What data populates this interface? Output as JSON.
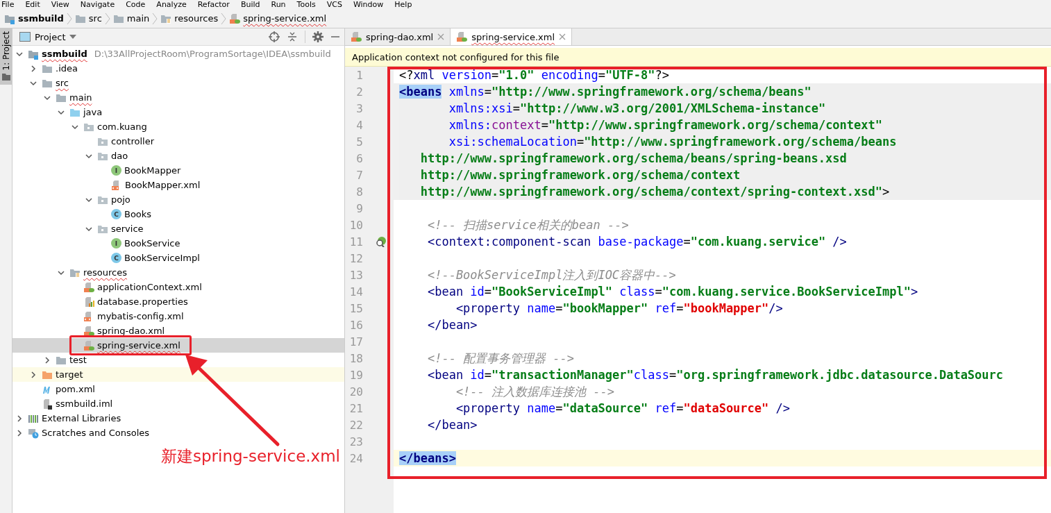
{
  "menu": [
    "File",
    "Edit",
    "View",
    "Navigate",
    "Code",
    "Analyze",
    "Refactor",
    "Build",
    "Run",
    "Tools",
    "VCS",
    "Window",
    "Help"
  ],
  "breadcrumbs": [
    {
      "label": "ssmbuild",
      "kind": "module"
    },
    {
      "label": "src",
      "kind": "folder"
    },
    {
      "label": "main",
      "kind": "folder"
    },
    {
      "label": "resources",
      "kind": "resources"
    },
    {
      "label": "spring-service.xml",
      "kind": "spring-xml",
      "typo": true
    }
  ],
  "tool_stripe": {
    "label": "1: Project"
  },
  "project": {
    "title": "Project",
    "tree": [
      {
        "label": "ssmbuild",
        "path": "D:\\33AllProjectRoom\\ProgramSortage\\IDEA\\ssmbuild",
        "kind": "module",
        "expanded": true,
        "selected": false,
        "typo": true,
        "children": [
          {
            "label": ".idea",
            "kind": "folder",
            "expanded": false,
            "selected": false
          },
          {
            "label": "src",
            "kind": "folder",
            "expanded": true,
            "selected": false,
            "typo": true,
            "children": [
              {
                "label": "main",
                "kind": "folder",
                "expanded": true,
                "selected": false,
                "typo": true,
                "children": [
                  {
                    "label": "java",
                    "kind": "source",
                    "expanded": true,
                    "selected": false,
                    "children": [
                      {
                        "label": "com.kuang",
                        "kind": "package",
                        "expanded": true,
                        "selected": false,
                        "children": [
                          {
                            "label": "controller",
                            "kind": "package",
                            "selected": false
                          },
                          {
                            "label": "dao",
                            "kind": "package",
                            "expanded": true,
                            "selected": false,
                            "children": [
                              {
                                "label": "BookMapper",
                                "kind": "interface",
                                "letter": "I",
                                "selected": false
                              },
                              {
                                "label": "BookMapper.xml",
                                "kind": "xml",
                                "selected": false
                              }
                            ]
                          },
                          {
                            "label": "pojo",
                            "kind": "package",
                            "expanded": true,
                            "selected": false,
                            "children": [
                              {
                                "label": "Books",
                                "kind": "class",
                                "letter": "C",
                                "selected": false
                              }
                            ]
                          },
                          {
                            "label": "service",
                            "kind": "package",
                            "expanded": true,
                            "selected": false,
                            "children": [
                              {
                                "label": "BookService",
                                "kind": "interface",
                                "letter": "I",
                                "selected": false
                              },
                              {
                                "label": "BookServiceImpl",
                                "kind": "class",
                                "letter": "C",
                                "selected": false
                              }
                            ]
                          }
                        ]
                      }
                    ]
                  },
                  {
                    "label": "resources",
                    "kind": "resources",
                    "expanded": true,
                    "selected": false,
                    "typo": true,
                    "children": [
                      {
                        "label": "applicationContext.xml",
                        "kind": "spring-xml",
                        "selected": false
                      },
                      {
                        "label": "database.properties",
                        "kind": "properties",
                        "selected": false
                      },
                      {
                        "label": "mybatis-config.xml",
                        "kind": "xml",
                        "selected": false
                      },
                      {
                        "label": "spring-dao.xml",
                        "kind": "spring-xml",
                        "selected": false
                      },
                      {
                        "label": "spring-service.xml",
                        "kind": "spring-xml",
                        "selected": true,
                        "typo": true
                      }
                    ]
                  }
                ]
              },
              {
                "label": "test",
                "kind": "folder",
                "expanded": false,
                "selected": false
              }
            ]
          },
          {
            "label": "target",
            "kind": "excluded",
            "expanded": false,
            "selected": false
          },
          {
            "label": "pom.xml",
            "kind": "maven",
            "selected": false
          },
          {
            "label": "ssmbuild.iml",
            "kind": "iml",
            "selected": false
          }
        ]
      },
      {
        "label": "External Libraries",
        "kind": "libraries",
        "expanded": false,
        "selected": false
      },
      {
        "label": "Scratches and Consoles",
        "kind": "scratches",
        "expanded": false,
        "selected": false
      }
    ]
  },
  "tabs": [
    {
      "label": "spring-dao.xml",
      "selected": false
    },
    {
      "label": "spring-service.xml",
      "selected": true,
      "typo": true
    }
  ],
  "banner": "Application context not configured for this file",
  "editor": {
    "lines": [
      {
        "n": "1",
        "kind": "plain",
        "tokens": [
          {
            "kind": "p",
            "text": "<?"
          },
          {
            "kind": "tag",
            "text": "xml"
          },
          {
            "kind": "attr",
            "text": " version"
          },
          {
            "kind": "p",
            "text": "="
          },
          {
            "kind": "val",
            "text": "\"1.0\""
          },
          {
            "kind": "attr",
            "text": " encoding"
          },
          {
            "kind": "p",
            "text": "="
          },
          {
            "kind": "val",
            "text": "\"UTF-8\""
          },
          {
            "kind": "p",
            "text": "?>"
          }
        ]
      },
      {
        "n": "2",
        "kind": "scope",
        "tokens": [
          {
            "kind": "match",
            "text": "<beans"
          },
          {
            "kind": "attr",
            "text": " xmlns"
          },
          {
            "kind": "p",
            "text": "="
          },
          {
            "kind": "val",
            "text": "\"http://www.springframework.org/schema/beans\""
          }
        ]
      },
      {
        "n": "3",
        "kind": "scope",
        "tokens": [
          {
            "kind": "attr",
            "text": "       xmlns:xsi"
          },
          {
            "kind": "p",
            "text": "="
          },
          {
            "kind": "val",
            "text": "\"http://www.w3.org/2001/XMLSchema-instance\""
          }
        ]
      },
      {
        "n": "4",
        "kind": "scope",
        "tokens": [
          {
            "kind": "attr",
            "text": "       xmlns:"
          },
          {
            "kind": "ns",
            "text": "context"
          },
          {
            "kind": "p",
            "text": "="
          },
          {
            "kind": "val",
            "text": "\"http://www.springframework.org/schema/context\""
          }
        ]
      },
      {
        "n": "5",
        "kind": "scope",
        "tokens": [
          {
            "kind": "attr",
            "text": "       xsi:schemaLocation"
          },
          {
            "kind": "p",
            "text": "="
          },
          {
            "kind": "val",
            "text": "\"http://www.springframework.org/schema/beans"
          }
        ]
      },
      {
        "n": "6",
        "kind": "scope",
        "tokens": [
          {
            "kind": "val",
            "text": "   http://www.springframework.org/schema/beans/spring-beans.xsd"
          }
        ]
      },
      {
        "n": "7",
        "kind": "scope",
        "tokens": [
          {
            "kind": "val",
            "text": "   http://www.springframework.org/schema/context"
          }
        ]
      },
      {
        "n": "8",
        "kind": "scope",
        "tokens": [
          {
            "kind": "val",
            "text": "   http://www.springframework.org/schema/context/spring-context.xsd\""
          },
          {
            "kind": "p",
            "text": ">"
          }
        ]
      },
      {
        "n": "9",
        "kind": "plain"
      },
      {
        "n": "10",
        "kind": "plain",
        "tokens": [
          {
            "kind": "comment",
            "text": "    <!-- 扫描service相关的bean -->"
          }
        ]
      },
      {
        "n": "11",
        "kind": "plain",
        "gutter_icon": true,
        "tokens": [
          {
            "kind": "tag",
            "text": "    <context:component-scan"
          },
          {
            "kind": "attr",
            "text": " base-package"
          },
          {
            "kind": "p",
            "text": "="
          },
          {
            "kind": "val",
            "text": "\"com.kuang.service\""
          },
          {
            "kind": "tag",
            "text": " />"
          }
        ]
      },
      {
        "n": "12",
        "kind": "plain"
      },
      {
        "n": "13",
        "kind": "plain",
        "tokens": [
          {
            "kind": "comment",
            "text": "    <!--BookServiceImpl注入到IOC容器中-->"
          }
        ]
      },
      {
        "n": "14",
        "kind": "plain",
        "tokens": [
          {
            "kind": "tag",
            "text": "    <bean"
          },
          {
            "kind": "attr",
            "text": " id"
          },
          {
            "kind": "p",
            "text": "="
          },
          {
            "kind": "val",
            "text": "\"BookServiceImpl\""
          },
          {
            "kind": "attr",
            "text": " class"
          },
          {
            "kind": "p",
            "text": "="
          },
          {
            "kind": "val",
            "text": "\"com.kuang.service.BookServiceImpl\""
          },
          {
            "kind": "tag",
            "text": ">"
          }
        ]
      },
      {
        "n": "15",
        "kind": "plain",
        "tokens": [
          {
            "kind": "tag",
            "text": "        <property"
          },
          {
            "kind": "attr",
            "text": " name"
          },
          {
            "kind": "p",
            "text": "="
          },
          {
            "kind": "val",
            "text": "\"bookMapper\""
          },
          {
            "kind": "attr",
            "text": " ref"
          },
          {
            "kind": "p",
            "text": "="
          },
          {
            "kind": "err",
            "text": "\"bookMapper\""
          },
          {
            "kind": "tag",
            "text": "/>"
          }
        ]
      },
      {
        "n": "16",
        "kind": "plain",
        "tokens": [
          {
            "kind": "tag",
            "text": "    </bean>"
          }
        ]
      },
      {
        "n": "17",
        "kind": "plain"
      },
      {
        "n": "18",
        "kind": "plain",
        "tokens": [
          {
            "kind": "comment",
            "text": "    <!-- 配置事务管理器 -->"
          }
        ]
      },
      {
        "n": "19",
        "kind": "plain",
        "tokens": [
          {
            "kind": "tag",
            "text": "    <bean"
          },
          {
            "kind": "attr",
            "text": " id"
          },
          {
            "kind": "p",
            "text": "="
          },
          {
            "kind": "val",
            "text": "\"transactionManager\""
          },
          {
            "kind": "attr",
            "text": "class"
          },
          {
            "kind": "p",
            "text": "="
          },
          {
            "kind": "val",
            "text": "\"org.springframework.jdbc.datasource.DataSourc"
          }
        ]
      },
      {
        "n": "20",
        "kind": "plain",
        "tokens": [
          {
            "kind": "comment",
            "text": "        <!-- 注入数据库连接池 -->"
          }
        ]
      },
      {
        "n": "21",
        "kind": "plain",
        "tokens": [
          {
            "kind": "tag",
            "text": "        <property"
          },
          {
            "kind": "attr",
            "text": " name"
          },
          {
            "kind": "p",
            "text": "="
          },
          {
            "kind": "val",
            "text": "\"dataSource\""
          },
          {
            "kind": "attr",
            "text": " ref"
          },
          {
            "kind": "p",
            "text": "="
          },
          {
            "kind": "err",
            "text": "\"dataSource\""
          },
          {
            "kind": "tag",
            "text": " />"
          }
        ]
      },
      {
        "n": "22",
        "kind": "plain",
        "tokens": [
          {
            "kind": "tag",
            "text": "    </bean>"
          }
        ]
      },
      {
        "n": "23",
        "kind": "plain"
      },
      {
        "n": "24",
        "kind": "current",
        "tokens": [
          {
            "kind": "match",
            "text": "</beans>"
          }
        ]
      }
    ]
  },
  "annotation": {
    "text": "新建spring-service.xml"
  }
}
